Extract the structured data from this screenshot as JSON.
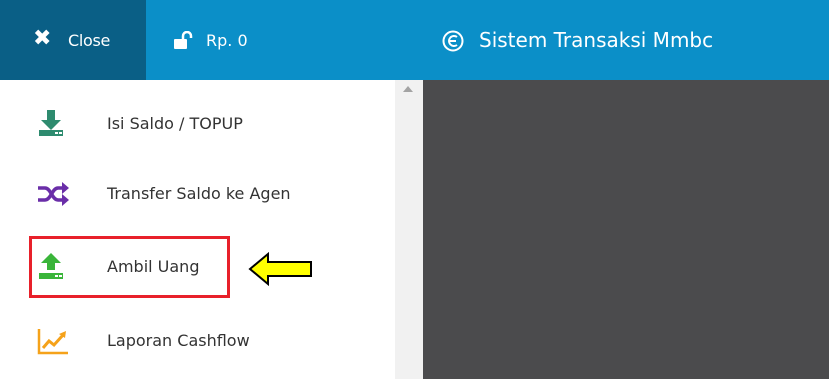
{
  "header": {
    "close_label": "Close",
    "balance": "Rp. 0",
    "app_title": "Sistem Transaksi Mmbc"
  },
  "menu": [
    {
      "label": "Isi Saldo / TOPUP",
      "icon": "download-tray-icon",
      "color": "#2e8b6f"
    },
    {
      "label": "Transfer Saldo ke Agen",
      "icon": "shuffle-icon",
      "color": "#6a2ea8"
    },
    {
      "label": "Ambil Uang",
      "icon": "upload-tray-icon",
      "color": "#3ab53a"
    },
    {
      "label": "Laporan Cashflow",
      "icon": "line-chart-icon",
      "color": "#f5a21a"
    }
  ],
  "annotation": {
    "highlight_color": "#e8202a",
    "arrow_color": "#ffff00"
  },
  "colors": {
    "header": "#0b8fc8",
    "close_button": "#0a5f86",
    "content_background": "#4b4b4d"
  }
}
